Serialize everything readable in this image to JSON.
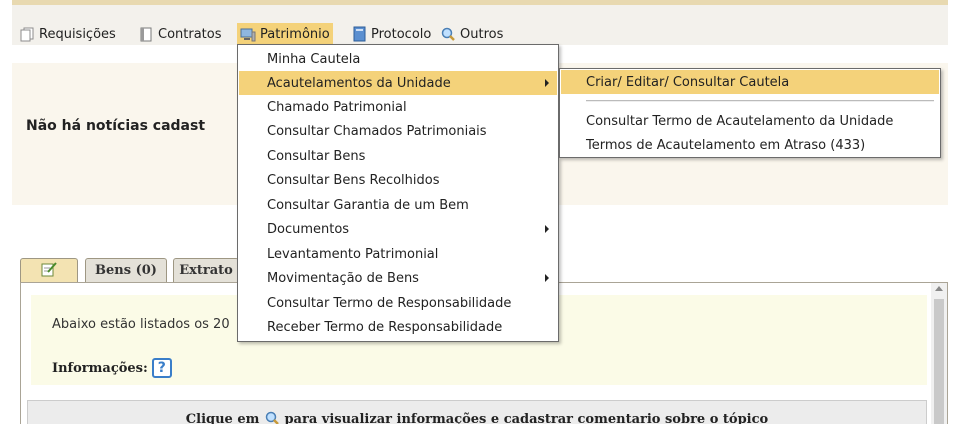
{
  "menubar": {
    "items": [
      {
        "label": "Requisições",
        "icon": "copy-icon"
      },
      {
        "label": "Contratos",
        "icon": "document-icon"
      },
      {
        "label": "Patrimônio",
        "icon": "monitor-icon"
      },
      {
        "label": "Protocolo",
        "icon": "notebook-icon"
      },
      {
        "label": "Outros",
        "icon": "search-icon"
      }
    ]
  },
  "news": {
    "text": "Não há notícias cadast"
  },
  "tabs": [
    {
      "label": "",
      "icon": "edit-note-icon"
    },
    {
      "label": "Bens (0)"
    },
    {
      "label": "Extrato"
    }
  ],
  "panel": {
    "info_line": "Abaixo estão listados os 20",
    "info_label": "Informações:",
    "help_label": "?",
    "click_prefix": "Clique em",
    "click_suffix": "para visualizar informações e cadastrar comentario sobre o tópico"
  },
  "dropdown": {
    "items": [
      {
        "label": "Minha Cautela"
      },
      {
        "label": "Acautelamentos da Unidade",
        "submenu": true
      },
      {
        "label": "Chamado Patrimonial"
      },
      {
        "label": "Consultar Chamados Patrimoniais"
      },
      {
        "label": "Consultar Bens"
      },
      {
        "label": "Consultar Bens Recolhidos"
      },
      {
        "label": "Consultar Garantia de um Bem"
      },
      {
        "label": "Documentos",
        "submenu": true
      },
      {
        "label": "Levantamento Patrimonial"
      },
      {
        "label": "Movimentação de Bens",
        "submenu": true
      },
      {
        "label": "Consultar Termo de Responsabilidade"
      },
      {
        "label": "Receber Termo de Responsabilidade"
      }
    ]
  },
  "submenu": {
    "items": [
      {
        "label": "Criar/ Editar/ Consultar Cautela"
      },
      {
        "label": "Consultar Termo de Acautelamento da Unidade"
      },
      {
        "label": "Termos de Acautelamento em Atraso (433)"
      }
    ]
  },
  "colors": {
    "highlight": "#f4d27a",
    "news_bg": "#faf6ed",
    "info_bg": "#fbfbe7"
  }
}
